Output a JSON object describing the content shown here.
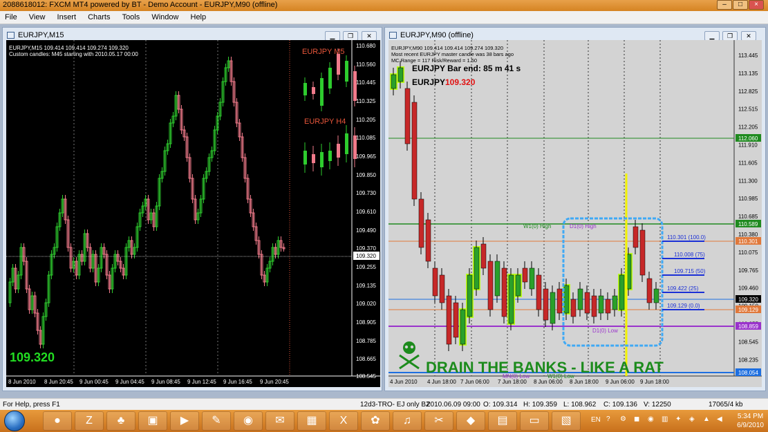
{
  "app": {
    "title": "2088618012: FXCM MT4 powered by BT - Demo Account - EURJPY,M90 (offline)",
    "controls": [
      "–",
      "□",
      "×"
    ]
  },
  "menu": [
    "File",
    "View",
    "Insert",
    "Charts",
    "Tools",
    "Window",
    "Help"
  ],
  "left_window": {
    "title": "EURJPY,M15",
    "info_line1": "EURJPY,M15  109.414 109.414 109.274 109.320",
    "info_line2": "Custom candles: M45 starting with 2010.05.17 00:00",
    "label_m5": "EURJPY M5",
    "label_h4": "EURJPY H4",
    "big_price": "109.320",
    "price_axis": [
      "110.680",
      "110.560",
      "110.445",
      "110.325",
      "110.205",
      "110.085",
      "109.965",
      "109.850",
      "109.730",
      "109.610",
      "109.490",
      "109.370",
      "109.255",
      "109.135",
      "109.020",
      "108.905",
      "108.785",
      "108.665",
      "108.545"
    ],
    "current_price": "109.320",
    "time_axis": [
      "8 Jun 2010",
      "8 Jun 20:45",
      "9 Jun 00:45",
      "9 Jun 04:45",
      "9 Jun 08:45",
      "9 Jun 12:45",
      "9 Jun 16:45",
      "9 Jun 20:45"
    ],
    "colors": {
      "bull": "#2ecc2e",
      "bear": "#f07a8a",
      "bg": "#000000",
      "text": "#ffffff",
      "label": "#e8563a",
      "price": "#22dd22"
    }
  },
  "right_window": {
    "title": "EURJPY,M90 (offline)",
    "info_line1": "EURJPY,M90  109.414 109.414 109.274 109.320",
    "info_line2": "Most recent EURJPY master candle was 38 bars ago",
    "info_line3": "MC Range = 117  Risk/Reward = 1.50",
    "bar_end": "EURJPY Bar end: 85 m 41 s",
    "symbol": "EURJPY",
    "symbol_price": "109.320",
    "price_axis": [
      "113.445",
      "113.135",
      "112.825",
      "112.515",
      "112.205",
      "111.910",
      "111.605",
      "111.300",
      "110.985",
      "110.685",
      "110.380",
      "110.075",
      "109.765",
      "109.460",
      "109.150",
      "108.855",
      "108.545",
      "108.235"
    ],
    "marked_prices": {
      "w1_high": "110.589",
      "d1_high": "110.301",
      "last": "109.320",
      "d1_low": "109.129",
      "mn_low": "108.859",
      "bottom": "108.054",
      "top_green": "112.060"
    },
    "fib_levels": [
      "110.301 (100.0)",
      "110.008 (75)",
      "109.715 (50)",
      "109.422 (25)",
      "109.129 (0.0)"
    ],
    "line_labels": {
      "w1_high": "W1(0) High",
      "d1_high": "D1(0) High",
      "d1_low": "D1(0) Low",
      "mn_low": "MN(0) Low",
      "w1_low": "W1(0) Low"
    },
    "banner": "DRAIN THE BANKS - LIKE A RAT",
    "time_axis": [
      "4 Jun 2010",
      "4 Jun 18:00",
      "7 Jun 06:00",
      "7 Jun 18:00",
      "8 Jun 06:00",
      "8 Jun 18:00",
      "9 Jun 06:00",
      "9 Jun 18:00"
    ],
    "colors": {
      "bull": "#2aa02a",
      "bear": "#c62828",
      "bg": "#d3d3d3",
      "highlight": "#b7ff1a",
      "box": "#3fa9f5",
      "fib": "#1a2fd6",
      "green_line": "#1f8a1f",
      "purple_line": "#9a33cc",
      "orange_line": "#e0783a",
      "blue_line": "#1e6fe0",
      "yellow": "#f2f200",
      "banner": "#1c8b1c"
    }
  },
  "statusbar": {
    "help": "For Help, press F1",
    "profile": "12d3-TRO- EJ only BZ",
    "datetime": "2010.06.09 09:00",
    "open": "O: 109.314",
    "high": "H: 109.359",
    "low": "L: 108.962",
    "close": "C: 109.136",
    "volume": "V: 12250",
    "traffic": "17065/4 kb"
  },
  "taskbar": {
    "lang": "EN",
    "time": "5:34 PM",
    "date": "6/9/2010"
  }
}
